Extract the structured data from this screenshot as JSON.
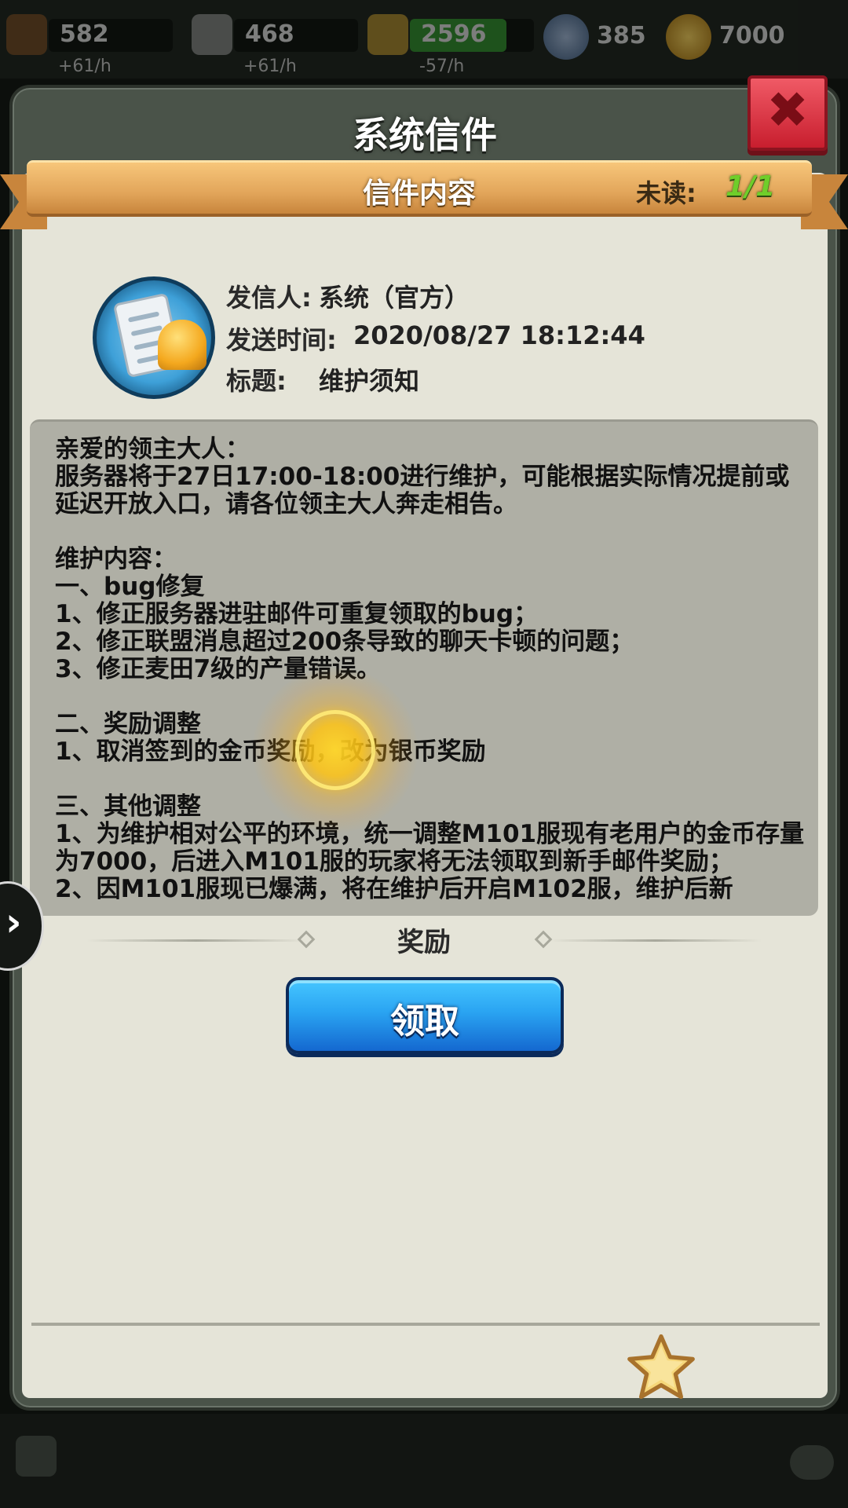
{
  "resources": [
    {
      "value": "582",
      "rate": "+61/h",
      "icon": "wood-icon",
      "color": "#8b5a2b",
      "fill": 0
    },
    {
      "value": "468",
      "rate": "+61/h",
      "icon": "stone-icon",
      "color": "#9a9a9a",
      "fill": 0
    },
    {
      "value": "2596",
      "rate": "-57/h",
      "icon": "wheat-icon",
      "color": "#c9a23a",
      "fill": 0.78
    }
  ],
  "currencies": [
    {
      "value": "385",
      "icon": "silver-coin-icon",
      "color": "#6a84a8"
    },
    {
      "value": "7000",
      "icon": "gold-coin-icon",
      "color": "#d49a1a"
    }
  ],
  "panel": {
    "title": "系统信件"
  },
  "ribbon": {
    "title": "信件内容",
    "unread_label": "未读:",
    "unread_count": "1/1"
  },
  "mail": {
    "sender_label": "发信人:",
    "sender": "系统（官方）",
    "time_label": "发送时间:",
    "time": "2020/08/27 18:12:44",
    "subject_label": "标题:",
    "subject": "维护须知",
    "body": "亲爱的领主大人：\n服务器将于27日17:00-18:00进行维护，可能根据实际情况提前或延迟开放入口，请各位领主大人奔走相告。\n\n维护内容：\n一、bug修复\n1、修正服务器进驻邮件可重复领取的bug；\n2、修正联盟消息超过200条导致的聊天卡顿的问题；\n3、修正麦田7级的产量错误。\n\n二、奖励调整\n1、取消签到的金币奖励，改为银币奖励\n\n三、其他调整\n1、为维护相对公平的环境，统一调整M101服现有老用户的金币存量为7000，后进入M101服的玩家将无法领取到新手邮件奖励；\n2、因M101服现已爆满，将在维护后开启M102服，维护后新"
  },
  "reward": {
    "label": "奖励",
    "claim_label": "领取"
  },
  "icons": {
    "close": "close-icon",
    "side_arrow": "chevron-right-icon",
    "star": "star-icon",
    "mail": "mail-bell-icon",
    "chat": "chat-icon"
  }
}
